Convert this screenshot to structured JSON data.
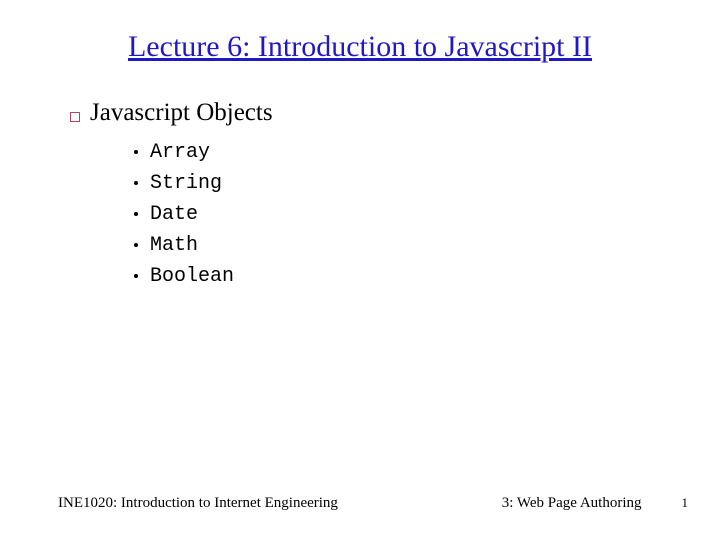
{
  "title": "Lecture 6: Introduction to Javascript II",
  "main": {
    "heading": "Javascript Objects",
    "items": [
      "Array",
      "String",
      "Date",
      "Math",
      "Boolean"
    ]
  },
  "footer": {
    "left": "INE1020: Introduction to Internet Engineering",
    "right": "3: Web Page Authoring",
    "page": "1"
  }
}
